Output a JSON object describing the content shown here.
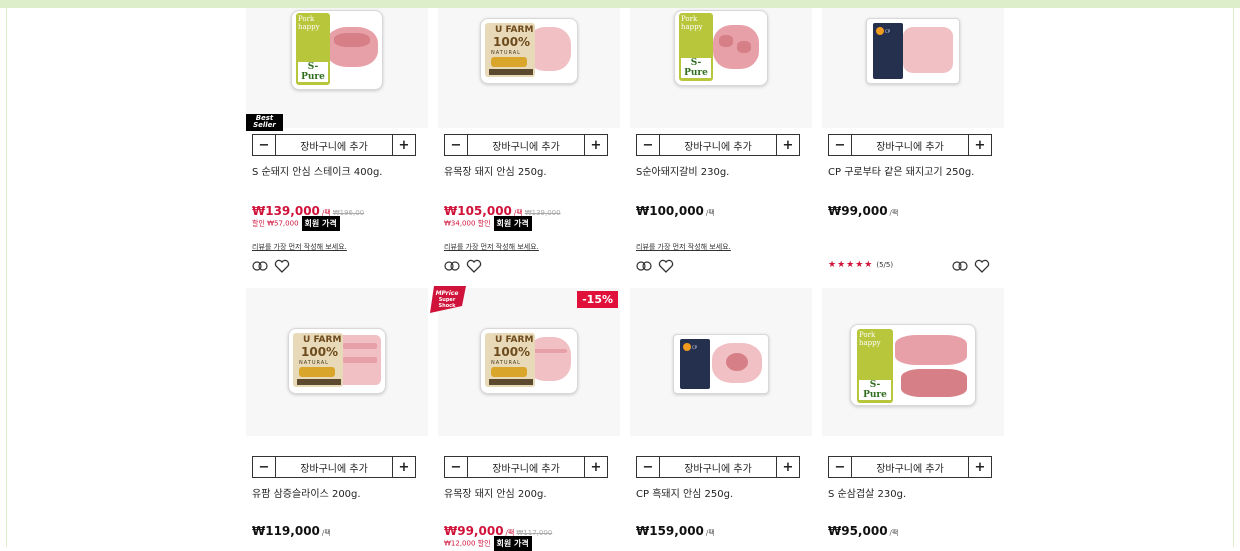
{
  "cart": {
    "minus": "−",
    "add_label": "장바구니에 추가",
    "plus": "+"
  },
  "review_prompt": "리뷰를 가장 먼저 작성해 보세요.",
  "member_label": "회원 가격",
  "badges": {
    "best_seller": "Best Seller",
    "mprice": "MPrice Super Shock",
    "discount": "-15%"
  },
  "products": [
    {
      "name": "S 순돼지 안심 스테이크 400g.",
      "price": "₩139,000",
      "unit": "/팩",
      "orig": "₩196,00",
      "save": "할인 ₩57,000",
      "member": true,
      "sale": true,
      "review": true
    },
    {
      "name": "유목장 돼지 안심 250g.",
      "price": "₩105,000",
      "unit": "/팩",
      "orig": "₩139,000",
      "save": "₩34,000 할인",
      "member": true,
      "sale": true,
      "review": true
    },
    {
      "name": "S순아돼지갈비 230g.",
      "price": "₩100,000",
      "unit": "/팩",
      "orig": "",
      "save": "",
      "member": false,
      "sale": false,
      "review": true
    },
    {
      "name": "CP 구로부타 같은 돼지고기 250g.",
      "price": "₩99,000",
      "unit": "/팩",
      "orig": "",
      "save": "",
      "member": false,
      "sale": false,
      "review": false,
      "stars": "★★★★★",
      "score": "(5/5)"
    },
    {
      "name": "유팜 삼증슬라이스 200g.",
      "price": "₩119,000",
      "unit": "/팩",
      "orig": "",
      "save": "",
      "member": false,
      "sale": false
    },
    {
      "name": "유목장 돼지 안심 200g.",
      "price": "₩99,000",
      "unit": "/팩",
      "orig": "₩117,000",
      "save": "₩12,000 할인",
      "member": true,
      "sale": true
    },
    {
      "name": "CP 흑돼지 안심 250g.",
      "price": "₩159,000",
      "unit": "/팩",
      "orig": "",
      "save": "",
      "member": false,
      "sale": false
    },
    {
      "name": "S 순삼겹살 230g.",
      "price": "₩95,000",
      "unit": "/팩",
      "orig": "",
      "save": "",
      "member": false,
      "sale": false
    }
  ],
  "package_text": {
    "pork_happy": "Pork happy",
    "s_pure": "S-Pure",
    "ufarm": "U FARM",
    "hundred": "100%",
    "natural": "NATURAL"
  },
  "colors": {
    "sale": "#d0133a",
    "accent_green": "#ddeecb"
  },
  "icons": [
    "compare-icon",
    "heart-icon"
  ]
}
